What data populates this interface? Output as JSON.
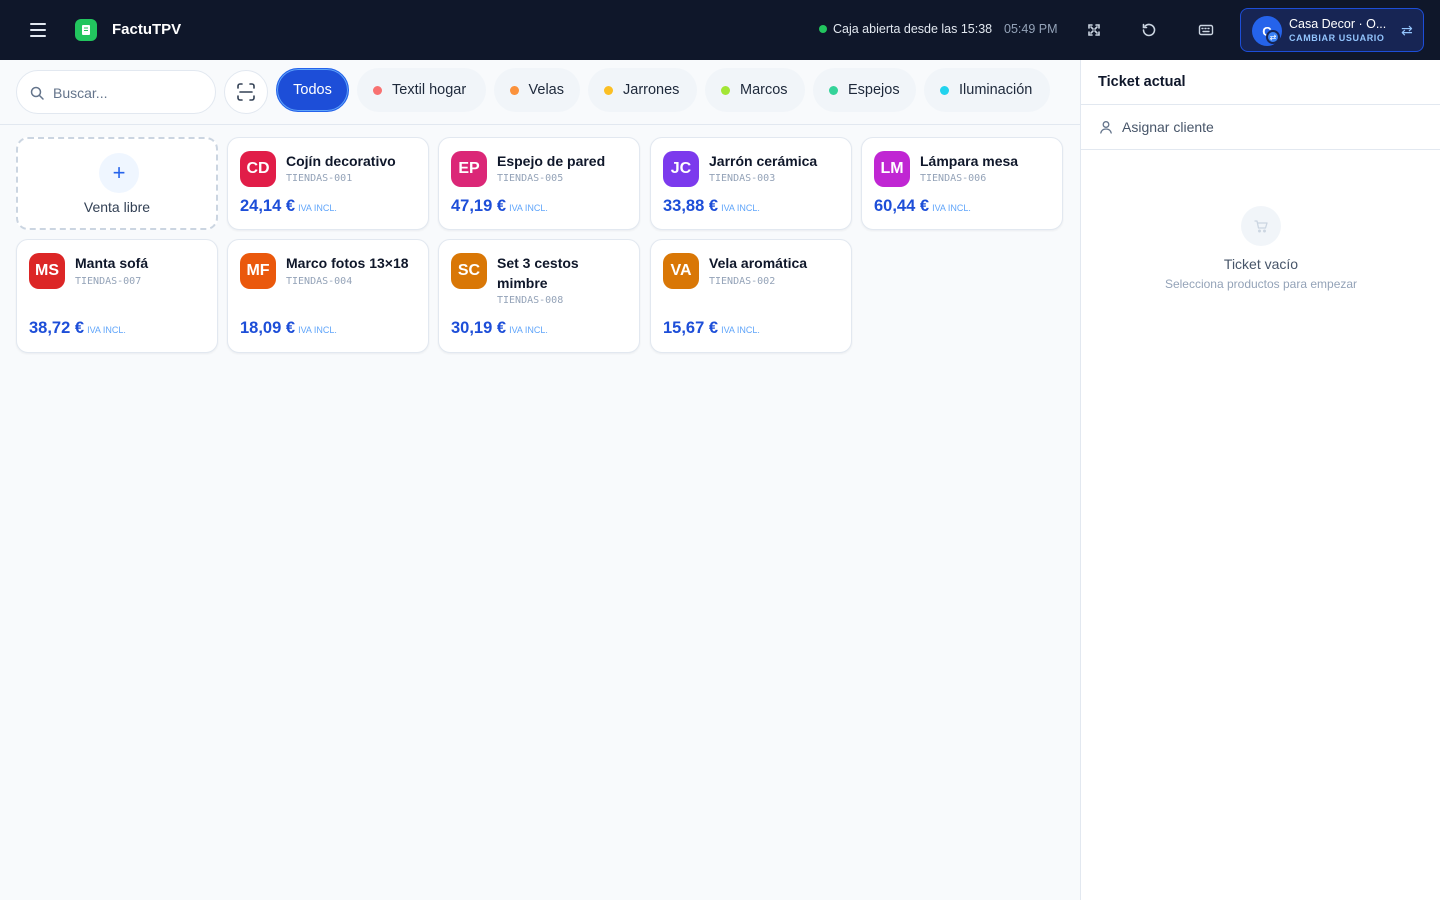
{
  "header": {
    "app_title": "FactuTPV",
    "status_text": "Caja abierta desde las 15:38",
    "time": "05:49 PM",
    "user": {
      "name": "Casa Decor · O...",
      "action_label": "CAMBIAR USUARIO",
      "avatar_initial": "C"
    },
    "icons": [
      "menu-icon",
      "app-logo-icon",
      "fullscreen-icon",
      "refresh-icon",
      "keyboard-icon",
      "swap-icon"
    ]
  },
  "search": {
    "placeholder": "Buscar..."
  },
  "categories": [
    {
      "label": "Todos",
      "active": true,
      "color": "#1d4ed8"
    },
    {
      "label": "Textil hogar",
      "color": "#f87171"
    },
    {
      "label": "Velas",
      "color": "#fb923c"
    },
    {
      "label": "Jarrones",
      "color": "#fbbf24"
    },
    {
      "label": "Marcos",
      "color": "#a3e635"
    },
    {
      "label": "Espejos",
      "color": "#34d399"
    },
    {
      "label": "Iluminación",
      "color": "#22d3ee"
    }
  ],
  "free_sale": {
    "label": "Venta libre",
    "icon": "plus-icon"
  },
  "products": [
    {
      "initials": "CD",
      "name": "Cojín decorativo",
      "sku": "TIENDAS-001",
      "price": "24,14 €",
      "tax": "IVA INCL.",
      "color": "#e11d48"
    },
    {
      "initials": "EP",
      "name": "Espejo de pared",
      "sku": "TIENDAS-005",
      "price": "47,19 €",
      "tax": "IVA INCL.",
      "color": "#db2777"
    },
    {
      "initials": "JC",
      "name": "Jarrón cerámica",
      "sku": "TIENDAS-003",
      "price": "33,88 €",
      "tax": "IVA INCL.",
      "color": "#7c3aed"
    },
    {
      "initials": "LM",
      "name": "Lámpara mesa",
      "sku": "TIENDAS-006",
      "price": "60,44 €",
      "tax": "IVA INCL.",
      "color": "#c026d3"
    },
    {
      "initials": "MS",
      "name": "Manta sofá",
      "sku": "TIENDAS-007",
      "price": "38,72 €",
      "tax": "IVA INCL.",
      "color": "#dc2626"
    },
    {
      "initials": "MF",
      "name": "Marco fotos 13×18",
      "sku": "TIENDAS-004",
      "price": "18,09 €",
      "tax": "IVA INCL.",
      "color": "#ea580c"
    },
    {
      "initials": "SC",
      "name": "Set 3 cestos mimbre",
      "sku": "TIENDAS-008",
      "price": "30,19 €",
      "tax": "IVA INCL.",
      "color": "#d97706"
    },
    {
      "initials": "VA",
      "name": "Vela aromática",
      "sku": "TIENDAS-002",
      "price": "15,67 €",
      "tax": "IVA INCL.",
      "color": "#d97706"
    }
  ],
  "ticket": {
    "title": "Ticket actual",
    "assign_label": "Asignar cliente",
    "empty_title": "Ticket vacío",
    "empty_subtitle": "Selecciona productos para empezar"
  }
}
